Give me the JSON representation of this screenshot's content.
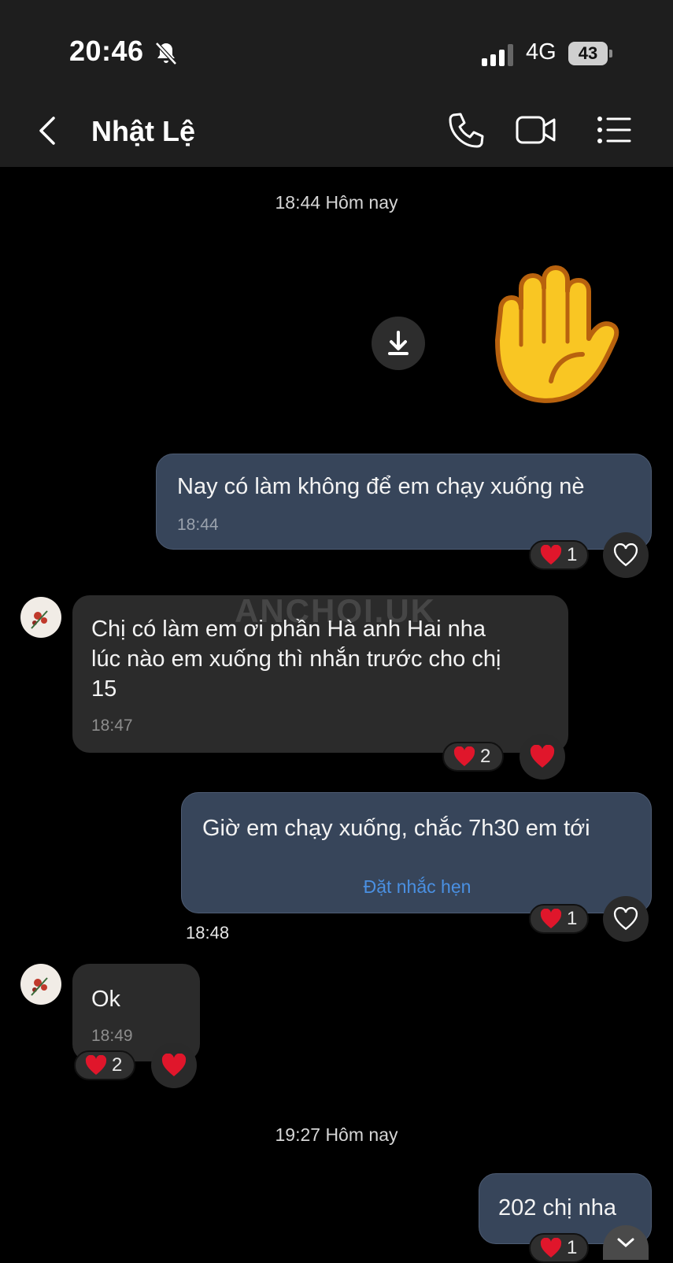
{
  "status_bar": {
    "time": "20:46",
    "network": "4G",
    "battery": "43"
  },
  "header": {
    "contact_name": "Nhật Lệ"
  },
  "watermark": "ANCHOI.UK",
  "timestamps": [
    "18:44 Hôm nay",
    "19:27 Hôm nay"
  ],
  "messages": [
    {
      "dir": "out",
      "text": "Nay có làm không để em chạy xuống nè",
      "time": "18:44",
      "reaction_count": "1"
    },
    {
      "dir": "in",
      "lines": [
        "Chị có làm em ơi phần Hà anh Hai nha",
        "lúc nào em xuống thì nhắn trước cho chị",
        "15"
      ],
      "time": "18:47",
      "reaction_count": "2"
    },
    {
      "dir": "out",
      "text": "Giờ em chạy xuống, chắc 7h30 em tới",
      "action": "Đặt nhắc hẹn",
      "time": "18:48",
      "reaction_count": "1"
    },
    {
      "dir": "in",
      "text": "Ok",
      "time": "18:49",
      "reaction_count": "2"
    },
    {
      "dir": "out",
      "text": "202 chị nha",
      "reaction_count": "1"
    }
  ],
  "colors": {
    "outgoing_bubble": "#37455a",
    "incoming_bubble": "#2b2b2b",
    "link": "#4a90e2",
    "heart": "#e0162b"
  }
}
